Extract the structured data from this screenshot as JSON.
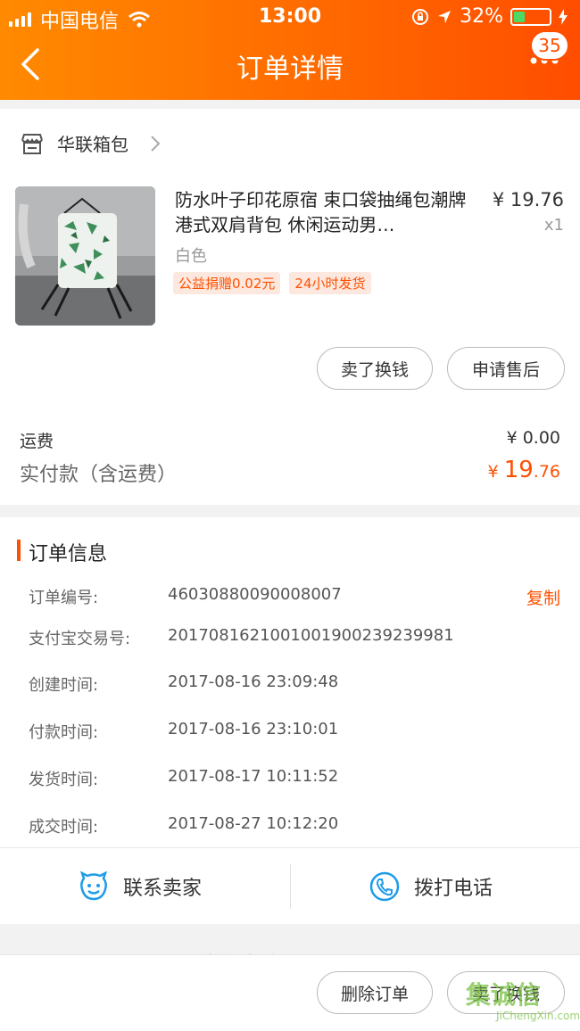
{
  "status_bar": {
    "carrier": "中国电信",
    "time": "13:00",
    "battery": "32%",
    "battery_level": 0.32
  },
  "nav": {
    "title": "订单详情",
    "badge_count": "35"
  },
  "shop": {
    "name": "华联箱包"
  },
  "product": {
    "title": "防水叶子印花原宿 束口袋抽绳包潮牌港式双肩背包 休闲运动男…",
    "price": "¥ 19.76",
    "qty": "x1",
    "sku": "白色",
    "tags": [
      "公益捐赠0.02元",
      "24小时发货"
    ]
  },
  "item_actions": {
    "sell_label": "卖了换钱",
    "after_sale_label": "申请售后"
  },
  "cost": {
    "shipping_label": "运费",
    "shipping_value": "¥ 0.00",
    "paid_label": "实付款（含运费）",
    "paid_currency": "¥",
    "paid_int": "19",
    "paid_dec": ".76"
  },
  "order_info": {
    "title": "订单信息",
    "copy_label": "复制",
    "rows": [
      {
        "key": "订单编号:",
        "value": "46030880090008007"
      },
      {
        "key": "支付宝交易号:",
        "value": "2017081621001001900239239981"
      },
      {
        "key": "创建时间:",
        "value": "2017-08-16 23:09:48"
      },
      {
        "key": "付款时间:",
        "value": "2017-08-16 23:10:01"
      },
      {
        "key": "发货时间:",
        "value": "2017-08-17 10:11:52"
      },
      {
        "key": "成交时间:",
        "value": "2017-08-27 10:12:20"
      }
    ]
  },
  "contact": {
    "seller_label": "联系卖家",
    "phone_label": "拨打电话"
  },
  "peek": {
    "text": "猜你喜欢"
  },
  "bottom": {
    "delete_label": "删除订单",
    "sell_label": "卖了换钱"
  },
  "watermark": {
    "text": "集诚信",
    "sub": "JiChengXin.com"
  },
  "colors": {
    "accent": "#ff5000",
    "header_start": "#ff8a00",
    "header_end": "#ff4d00"
  }
}
